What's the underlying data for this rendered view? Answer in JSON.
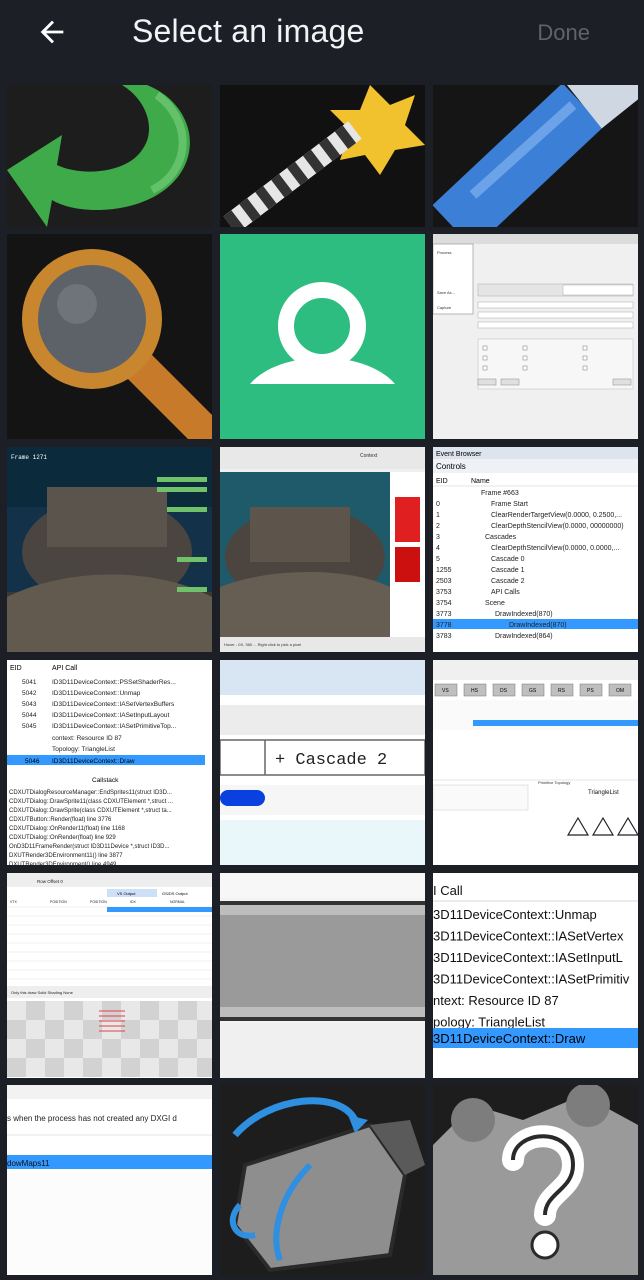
{
  "header": {
    "title": "Select an image",
    "done_label": "Done",
    "back_icon": "arrow-back-icon"
  },
  "tiles": {
    "t10": {
      "menu_items": [
        "Process",
        "Save As...",
        "Capture"
      ]
    },
    "t11": {
      "status": "Frame 1271"
    },
    "t12": {
      "toolbar": "Context",
      "status": "Hover - 0X, 360 ... Right click to pick a pixel"
    },
    "t13": {
      "title": "Event Browser",
      "controls": "Controls",
      "col_eid": "EID",
      "col_name": "Name",
      "rows": [
        {
          "eid": "",
          "name": "Frame #663"
        },
        {
          "eid": "0",
          "name": "Frame Start"
        },
        {
          "eid": "1",
          "name": "ClearRenderTargetView(0.0000, 0.2500,..."
        },
        {
          "eid": "2",
          "name": "ClearDepthStencilView(0.0000, 00000000)"
        },
        {
          "eid": "3",
          "name": "Cascades"
        },
        {
          "eid": "4",
          "name": "ClearDepthStencilView(0.0000, 0.0000,..."
        },
        {
          "eid": "5",
          "name": "Cascade 0"
        },
        {
          "eid": "1255",
          "name": "Cascade 1"
        },
        {
          "eid": "2503",
          "name": "Cascade 2"
        },
        {
          "eid": "3753",
          "name": "API Calls"
        },
        {
          "eid": "3754",
          "name": "Scene"
        },
        {
          "eid": "3773",
          "name": "DrawIndexed(870)"
        },
        {
          "eid": "3778",
          "name": "DrawIndexed(870)"
        },
        {
          "eid": "3783",
          "name": "DrawIndexed(864)"
        }
      ]
    },
    "t20": {
      "col_eid": "EID",
      "col_call": "API Call",
      "rows": [
        {
          "eid": "5041",
          "call": "ID3D11DeviceContext::PSSetShaderRes..."
        },
        {
          "eid": "5042",
          "call": "ID3D11DeviceContext::Unmap"
        },
        {
          "eid": "5043",
          "call": "ID3D11DeviceContext::IASetVertexBuffers"
        },
        {
          "eid": "5044",
          "call": "ID3D11DeviceContext::IASetInputLayout"
        },
        {
          "eid": "5045",
          "call": "ID3D11DeviceContext::IASetPrimitiveTop..."
        }
      ],
      "context": "context: Resource ID 87",
      "topology": "Topology: TriangleList",
      "selected_eid": "5046",
      "selected_call": "ID3D11DeviceContext::Draw",
      "callstack_label": "Callstack",
      "callstack": [
        "CDXUTDialogResourceManager::EndSprites11(struct ID3D...",
        "CDXUTDialog::DrawSprite11(class CDXUTElement *,struct ...",
        "CDXUTDialog::DrawSprite(class CDXUTElement *,struct ta...",
        "CDXUTButton::Render(float) line 3776",
        "CDXUTDialog::OnRender11(float) line 1168",
        "CDXUTDialog::OnRender(float) line 929",
        "OnD3D11FrameRender(struct ID3D11Device *,struct ID3D...",
        "DXUTRender3DEnvironment11() line 3877",
        "DXUTRender3DEnvironment() line 4949"
      ]
    },
    "t21": {
      "label": "+ Cascade 2"
    },
    "t22": {
      "stages": [
        "VS",
        "HS",
        "DS",
        "GS",
        "RS",
        "PS",
        "OM"
      ],
      "topology_label": "Primitive Topology",
      "topology": "TriangleList"
    },
    "t30": {
      "toolbar": "Row Offset 0",
      "tab1": "VS Output",
      "tab2": "GS/DS Output",
      "cols": [
        "VTX",
        "POSITION",
        "POSITION",
        "IDX",
        "NORMAL"
      ],
      "bottom_label": "Only this draw   Solid Shading  None"
    },
    "t32": {
      "header": "I Call",
      "lines": [
        "3D11DeviceContext::Unmap",
        "3D11DeviceContext::IASetVertex",
        "3D11DeviceContext::IASetInputL",
        "3D11DeviceContext::IASetPrimitiv",
        "ntext: Resource ID 87",
        "pology: TriangleList"
      ],
      "selected": "3D11DeviceContext::Draw"
    },
    "t40": {
      "message": "s when the process has not created any DXGI d",
      "selected": "dowMaps11"
    }
  },
  "icon_names": {
    "t00": "undo-arrow-icon",
    "t01": "magic-wand-icon",
    "t02": "marker-icon",
    "t03": "magnifier-icon",
    "t04": "user-avatar-icon",
    "t42": "help-question-icon",
    "t41": "camera-rotate-icon"
  },
  "colors": {
    "background": "#1c2026",
    "avatar_green": "#2dbd80",
    "selection_blue": "#3399ff"
  }
}
